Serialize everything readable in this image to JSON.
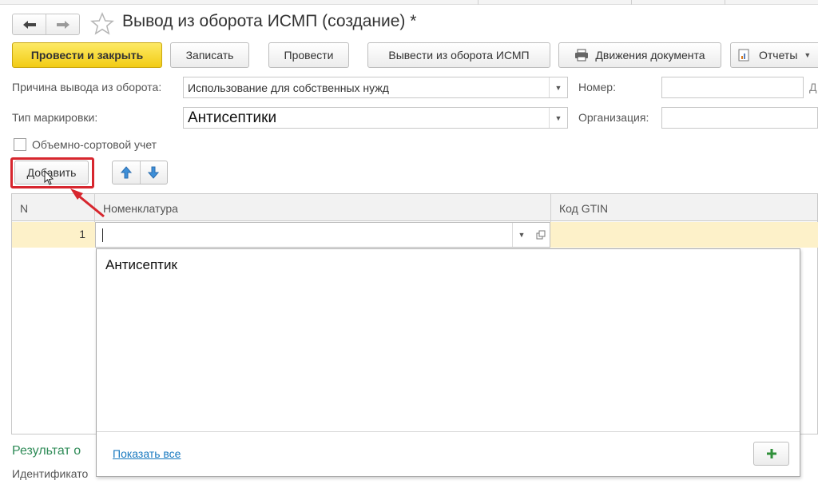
{
  "window": {
    "title": "Вывод из оборота ИСМП (создание) *"
  },
  "nav": {
    "back": "←",
    "forward": "→"
  },
  "toolbar": {
    "post_close": "Провести и закрыть",
    "save": "Записать",
    "post": "Провести",
    "withdraw": "Вывести из оборота ИСМП",
    "movements": "Движения документа",
    "reports": "Отчеты"
  },
  "form": {
    "reason_label": "Причина вывода из оборота:",
    "reason_value": "Использование для собственных нужд",
    "number_label": "Номер:",
    "number_value": "",
    "marking_label": "Тип маркировки:",
    "marking_value": "Антисептики",
    "org_label": "Организация:",
    "org_value": "",
    "volume_label": "Объемно-сортовой учет",
    "volume_checked": false
  },
  "table_toolbar": {
    "add": "Добавить"
  },
  "table": {
    "columns": [
      "N",
      "Номенклатура",
      "Код GTIN"
    ],
    "rows": [
      {
        "n": "1",
        "nomenclature": "",
        "gtin": ""
      }
    ]
  },
  "dropdown": {
    "items": [
      "Антисептик"
    ],
    "show_all": "Показать все"
  },
  "bottom": {
    "result_label": "Результат о",
    "identifier_label": "Идентификато"
  },
  "colors": {
    "primary": "#f2cc15",
    "highlight": "#d7262e",
    "row_selected": "#fdf1c9",
    "accent_green": "#2e8b57",
    "link": "#1a7ac0"
  }
}
